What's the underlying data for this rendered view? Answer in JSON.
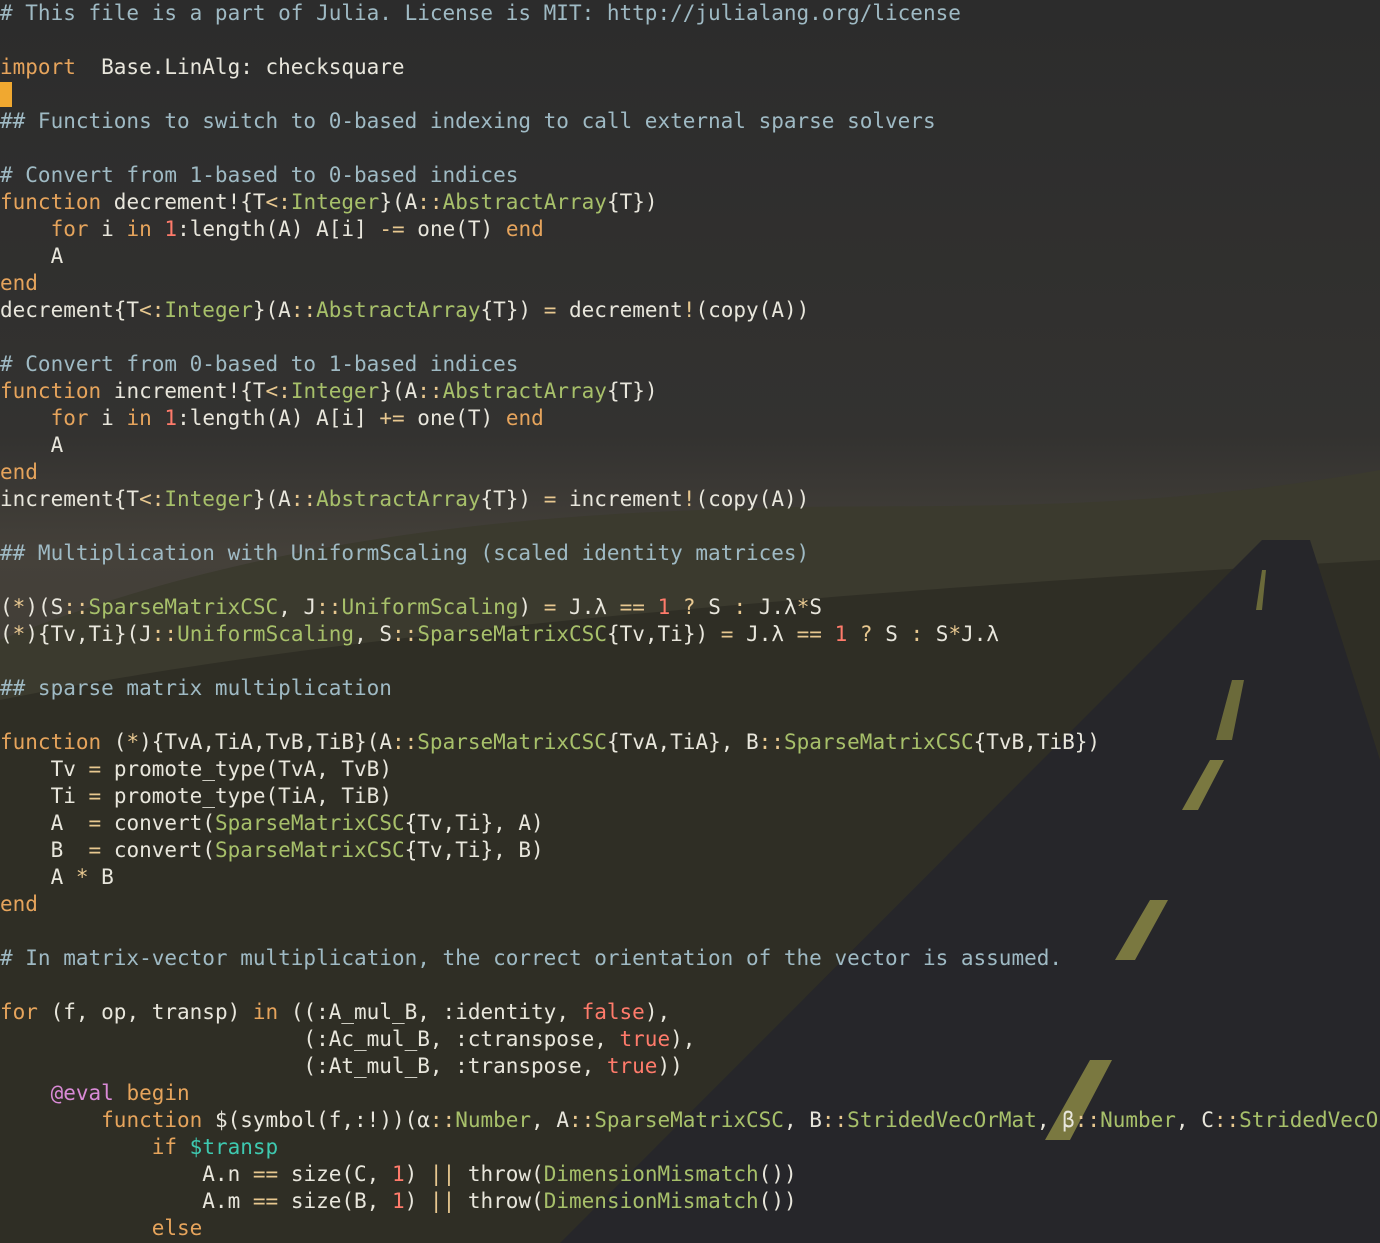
{
  "theme": {
    "background": "#2a2a2a",
    "comment": "#9fbac4",
    "keyword": "#e6a45c",
    "type": "#a7c06a",
    "number": "#ff7b6b",
    "text": "#e8e6dc",
    "cursor": "#f0a830"
  },
  "editor": {
    "lines": [
      [
        [
          "cm",
          "# This file is a part of Julia. License is MIT: http://julialang.org/license"
        ]
      ],
      [],
      [
        [
          "kw",
          "import"
        ],
        [
          "",
          "  Base.LinAlg: checksquare"
        ]
      ],
      [
        [
          "cursor",
          ""
        ]
      ],
      [
        [
          "cm",
          "## Functions to switch to 0-based indexing to call external sparse solvers"
        ]
      ],
      [],
      [
        [
          "cm",
          "# Convert from 1-based to 0-based indices"
        ]
      ],
      [
        [
          "kw",
          "function"
        ],
        [
          "",
          " decrement!{T"
        ],
        [
          "op",
          "<:"
        ],
        [
          "ty",
          "Integer"
        ],
        [
          "",
          "}(A"
        ],
        [
          "op",
          "::"
        ],
        [
          "ty",
          "AbstractArray"
        ],
        [
          "",
          "{T})"
        ]
      ],
      [
        [
          "",
          "    "
        ],
        [
          "kw",
          "for"
        ],
        [
          "",
          " i "
        ],
        [
          "kw",
          "in"
        ],
        [
          "",
          " "
        ],
        [
          "nm",
          "1"
        ],
        [
          "",
          ":length(A) A[i] "
        ],
        [
          "op",
          "-="
        ],
        [
          "",
          " one(T) "
        ],
        [
          "kw",
          "end"
        ]
      ],
      [
        [
          "",
          "    A"
        ]
      ],
      [
        [
          "kw",
          "end"
        ]
      ],
      [
        [
          "",
          "decrement{T"
        ],
        [
          "op",
          "<:"
        ],
        [
          "ty",
          "Integer"
        ],
        [
          "",
          "}(A"
        ],
        [
          "op",
          "::"
        ],
        [
          "ty",
          "AbstractArray"
        ],
        [
          "",
          "{T}) "
        ],
        [
          "op",
          "="
        ],
        [
          "",
          " decrement"
        ],
        [
          "op",
          "!"
        ],
        [
          "",
          "(copy(A))"
        ]
      ],
      [],
      [
        [
          "cm",
          "# Convert from 0-based to 1-based indices"
        ]
      ],
      [
        [
          "kw",
          "function"
        ],
        [
          "",
          " increment!{T"
        ],
        [
          "op",
          "<:"
        ],
        [
          "ty",
          "Integer"
        ],
        [
          "",
          "}(A"
        ],
        [
          "op",
          "::"
        ],
        [
          "ty",
          "AbstractArray"
        ],
        [
          "",
          "{T})"
        ]
      ],
      [
        [
          "",
          "    "
        ],
        [
          "kw",
          "for"
        ],
        [
          "",
          " i "
        ],
        [
          "kw",
          "in"
        ],
        [
          "",
          " "
        ],
        [
          "nm",
          "1"
        ],
        [
          "",
          ":length(A) A[i] "
        ],
        [
          "op",
          "+="
        ],
        [
          "",
          " one(T) "
        ],
        [
          "kw",
          "end"
        ]
      ],
      [
        [
          "",
          "    A"
        ]
      ],
      [
        [
          "kw",
          "end"
        ]
      ],
      [
        [
          "",
          "increment{T"
        ],
        [
          "op",
          "<:"
        ],
        [
          "ty",
          "Integer"
        ],
        [
          "",
          "}(A"
        ],
        [
          "op",
          "::"
        ],
        [
          "ty",
          "AbstractArray"
        ],
        [
          "",
          "{T}) "
        ],
        [
          "op",
          "="
        ],
        [
          "",
          " increment"
        ],
        [
          "op",
          "!"
        ],
        [
          "",
          "(copy(A))"
        ]
      ],
      [],
      [
        [
          "cm",
          "## Multiplication with UniformScaling (scaled identity matrices)"
        ]
      ],
      [],
      [
        [
          "",
          "("
        ],
        [
          "op",
          "*"
        ],
        [
          "",
          ")(S"
        ],
        [
          "op",
          "::"
        ],
        [
          "ty",
          "SparseMatrixCSC"
        ],
        [
          "",
          ", J"
        ],
        [
          "op",
          "::"
        ],
        [
          "ty",
          "UniformScaling"
        ],
        [
          "",
          ") "
        ],
        [
          "op",
          "="
        ],
        [
          "",
          " J.λ "
        ],
        [
          "op",
          "=="
        ],
        [
          "",
          " "
        ],
        [
          "nm",
          "1"
        ],
        [
          "",
          " "
        ],
        [
          "op",
          "?"
        ],
        [
          "",
          " S "
        ],
        [
          "op",
          ":"
        ],
        [
          "",
          " J.λ"
        ],
        [
          "op",
          "*"
        ],
        [
          "",
          "S"
        ]
      ],
      [
        [
          "",
          "("
        ],
        [
          "op",
          "*"
        ],
        [
          "",
          ")"
        ],
        [
          "",
          "{Tv,Ti}(J"
        ],
        [
          "op",
          "::"
        ],
        [
          "ty",
          "UniformScaling"
        ],
        [
          "",
          ", S"
        ],
        [
          "op",
          "::"
        ],
        [
          "ty",
          "SparseMatrixCSC"
        ],
        [
          "",
          "{Tv,Ti}) "
        ],
        [
          "op",
          "="
        ],
        [
          "",
          " J.λ "
        ],
        [
          "op",
          "=="
        ],
        [
          "",
          " "
        ],
        [
          "nm",
          "1"
        ],
        [
          "",
          " "
        ],
        [
          "op",
          "?"
        ],
        [
          "",
          " S "
        ],
        [
          "op",
          ":"
        ],
        [
          "",
          " S"
        ],
        [
          "op",
          "*"
        ],
        [
          "",
          "J.λ"
        ]
      ],
      [],
      [
        [
          "cm",
          "## sparse matrix multiplication"
        ]
      ],
      [],
      [
        [
          "kw",
          "function"
        ],
        [
          "",
          " ("
        ],
        [
          "op",
          "*"
        ],
        [
          "",
          ")"
        ],
        [
          "",
          "{TvA,TiA,TvB,TiB}(A"
        ],
        [
          "op",
          "::"
        ],
        [
          "ty",
          "SparseMatrixCSC"
        ],
        [
          "",
          "{TvA,TiA}, B"
        ],
        [
          "op",
          "::"
        ],
        [
          "ty",
          "SparseMatrixCSC"
        ],
        [
          "",
          "{TvB,TiB})"
        ]
      ],
      [
        [
          "",
          "    Tv "
        ],
        [
          "op",
          "="
        ],
        [
          "",
          " promote_type(TvA, TvB)"
        ]
      ],
      [
        [
          "",
          "    Ti "
        ],
        [
          "op",
          "="
        ],
        [
          "",
          " promote_type(TiA, TiB)"
        ]
      ],
      [
        [
          "",
          "    A  "
        ],
        [
          "op",
          "="
        ],
        [
          "",
          " convert("
        ],
        [
          "ty",
          "SparseMatrixCSC"
        ],
        [
          "",
          "{Tv,Ti}, A)"
        ]
      ],
      [
        [
          "",
          "    B  "
        ],
        [
          "op",
          "="
        ],
        [
          "",
          " convert("
        ],
        [
          "ty",
          "SparseMatrixCSC"
        ],
        [
          "",
          "{Tv,Ti}, B)"
        ]
      ],
      [
        [
          "",
          "    A "
        ],
        [
          "op",
          "*"
        ],
        [
          "",
          " B"
        ]
      ],
      [
        [
          "kw",
          "end"
        ]
      ],
      [],
      [
        [
          "cm",
          "# In matrix-vector multiplication, the correct orientation of the vector is assumed."
        ]
      ],
      [],
      [
        [
          "kw",
          "for"
        ],
        [
          "",
          " (f, op, transp) "
        ],
        [
          "kw",
          "in"
        ],
        [
          "",
          " ((:A_mul_B, :identity, "
        ],
        [
          "nm",
          "false"
        ],
        [
          "",
          "),"
        ]
      ],
      [
        [
          "",
          "                        (:Ac_mul_B, :ctranspose, "
        ],
        [
          "nm",
          "true"
        ],
        [
          "",
          "),"
        ]
      ],
      [
        [
          "",
          "                        (:At_mul_B, :transpose, "
        ],
        [
          "nm",
          "true"
        ],
        [
          "",
          "))"
        ]
      ],
      [
        [
          "",
          "    "
        ],
        [
          "mac",
          "@eval"
        ],
        [
          "",
          " "
        ],
        [
          "kw",
          "begin"
        ]
      ],
      [
        [
          "",
          "        "
        ],
        [
          "kw",
          "function"
        ],
        [
          "",
          " $(symbol(f,:!))(α"
        ],
        [
          "op",
          "::"
        ],
        [
          "ty",
          "Number"
        ],
        [
          "",
          ", A"
        ],
        [
          "op",
          "::"
        ],
        [
          "ty",
          "SparseMatrixCSC"
        ],
        [
          "",
          ", B"
        ],
        [
          "op",
          "::"
        ],
        [
          "ty",
          "StridedVecOrMat"
        ],
        [
          "",
          ", β"
        ],
        [
          "op",
          "::"
        ],
        [
          "ty",
          "Number"
        ],
        [
          "",
          ", C"
        ],
        [
          "op",
          "::"
        ],
        [
          "ty",
          "StridedVecOrMat"
        ],
        [
          "",
          ")"
        ]
      ],
      [
        [
          "",
          "            "
        ],
        [
          "kw",
          "if"
        ],
        [
          "",
          " "
        ],
        [
          "in",
          "$transp"
        ]
      ],
      [
        [
          "",
          "                A.n "
        ],
        [
          "op",
          "=="
        ],
        [
          "",
          " size(C, "
        ],
        [
          "nm",
          "1"
        ],
        [
          "",
          ") "
        ],
        [
          "op",
          "||"
        ],
        [
          "",
          " throw("
        ],
        [
          "ty",
          "DimensionMismatch"
        ],
        [
          "",
          "())"
        ]
      ],
      [
        [
          "",
          "                A.m "
        ],
        [
          "op",
          "=="
        ],
        [
          "",
          " size(B, "
        ],
        [
          "nm",
          "1"
        ],
        [
          "",
          ") "
        ],
        [
          "op",
          "||"
        ],
        [
          "",
          " throw("
        ],
        [
          "ty",
          "DimensionMismatch"
        ],
        [
          "",
          "())"
        ]
      ],
      [
        [
          "",
          "            "
        ],
        [
          "kw",
          "else"
        ]
      ]
    ]
  }
}
